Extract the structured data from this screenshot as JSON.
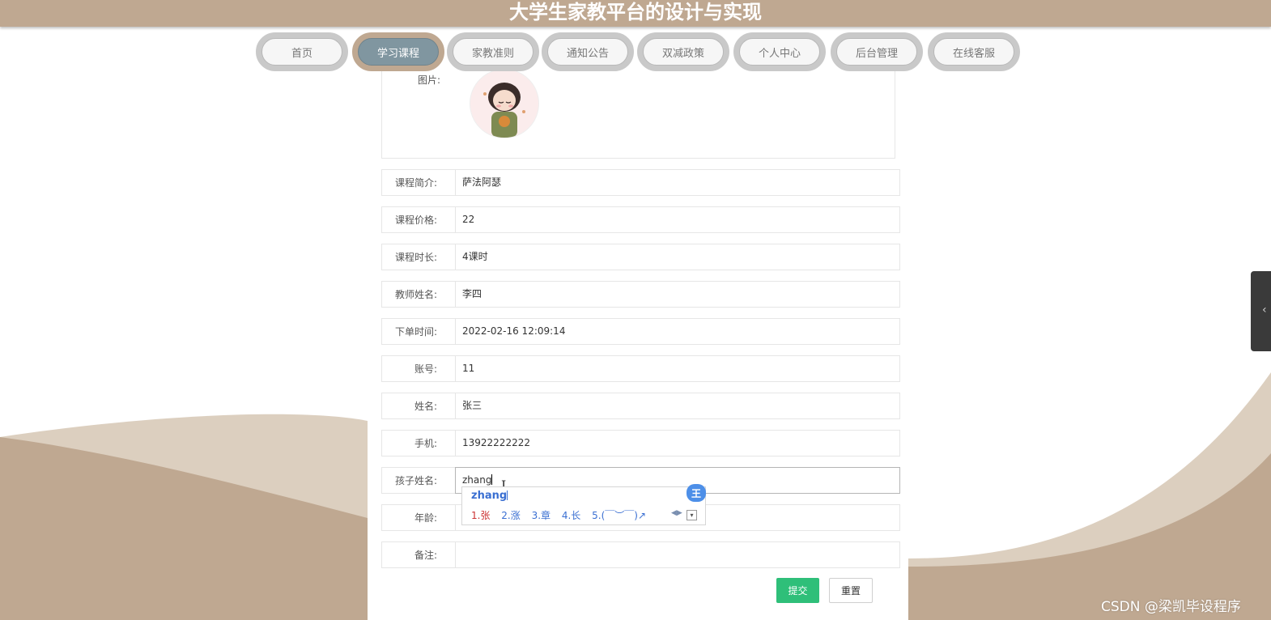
{
  "header": {
    "title": "大学生家教平台的设计与实现"
  },
  "nav": [
    {
      "label": "首页",
      "active": false
    },
    {
      "label": "学习课程",
      "active": true
    },
    {
      "label": "家教准则",
      "active": false
    },
    {
      "label": "通知公告",
      "active": false
    },
    {
      "label": "双减政策",
      "active": false
    },
    {
      "label": "个人中心",
      "active": false
    },
    {
      "label": "后台管理",
      "active": false
    },
    {
      "label": "在线客服",
      "active": false
    }
  ],
  "form": {
    "image_label": "图片:",
    "fields": [
      {
        "label": "课程简介:",
        "value": "萨法阿瑟"
      },
      {
        "label": "课程价格:",
        "value": "22"
      },
      {
        "label": "课程时长:",
        "value": "4课时"
      },
      {
        "label": "教师姓名:",
        "value": "李四"
      },
      {
        "label": "下单时间:",
        "value": "2022-02-16 12:09:14"
      },
      {
        "label": "账号:",
        "value": "11"
      },
      {
        "label": "姓名:",
        "value": "张三"
      },
      {
        "label": "手机:",
        "value": "13922222222"
      },
      {
        "label": "孩子姓名:",
        "value": "zhang"
      },
      {
        "label": "年龄:",
        "value": ""
      },
      {
        "label": "备注:",
        "value": ""
      }
    ],
    "submit_label": "提交",
    "reset_label": "重置"
  },
  "ime": {
    "composition": "zhang",
    "badge": "王",
    "candidates": [
      "1.张",
      "2.涨",
      "3.章",
      "4.长",
      "5.(￣︶￣)↗"
    ]
  },
  "watermark": "CSDN @梁凯毕设程序",
  "colors": {
    "header": "#bfa891",
    "active_tab": "#8096a0",
    "submit": "#2fbf79"
  }
}
